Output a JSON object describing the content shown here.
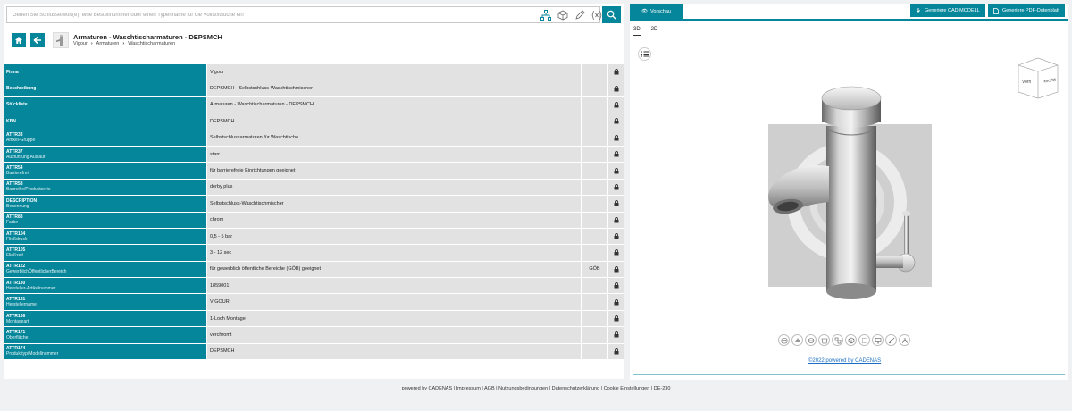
{
  "search": {
    "placeholder": "Geben Sie Schlüsselwort(e), eine Bestellnummer oder einen Typenname für die Volltextsuche ein",
    "value": ""
  },
  "toolbar_icons": [
    "hierarchy-icon",
    "cube-icon",
    "pen-icon",
    "variable-icon"
  ],
  "header": {
    "title": "Armaturen - Waschtischarmaturen - DEPSMCH",
    "breadcrumb": [
      "Vigour",
      "Armaturen",
      "Waschtischarmaturen"
    ]
  },
  "attributes": [
    {
      "key": "Firma",
      "desc": "",
      "value": "Vigour",
      "extra": ""
    },
    {
      "key": "Beschreibung",
      "desc": "",
      "value": "DEPSMCH - Selbstschluss-Waschtischmischer",
      "extra": ""
    },
    {
      "key": "Stückliste",
      "desc": "",
      "value": "Armaturen - Waschtischarmaturen - DEPSMCH",
      "extra": ""
    },
    {
      "key": "KBN",
      "desc": "",
      "value": "DEPSMCH",
      "extra": ""
    },
    {
      "key": "ATTR33",
      "desc": "Artikel-Gruppe",
      "value": "Selbstschlussarmaturen für Waschtische",
      "extra": ""
    },
    {
      "key": "ATTR37",
      "desc": "Ausführung Auslauf",
      "value": "starr",
      "extra": ""
    },
    {
      "key": "ATTR54",
      "desc": "Barrierefrei",
      "value": "für barrierefreie Einrichtungen geeignet",
      "extra": ""
    },
    {
      "key": "ATTR58",
      "desc": "Baureihe/Produktserie",
      "value": "derby plus",
      "extra": ""
    },
    {
      "key": "DESCRIPTION",
      "desc": "Benennung",
      "value": "Selbstschluss-Waschtischmischer",
      "extra": ""
    },
    {
      "key": "ATTR83",
      "desc": "Farbe",
      "value": "chrom",
      "extra": ""
    },
    {
      "key": "ATTR104",
      "desc": "Fließdruck",
      "value": "0,5 - 5 bar",
      "extra": ""
    },
    {
      "key": "ATTR105",
      "desc": "Fließzeit",
      "value": "3 - 12 sec",
      "extra": ""
    },
    {
      "key": "ATTR122",
      "desc": "GewerblichÖffentlicherBereich",
      "value": "für gewerblich öffentliche Bereiche (GÖB) geeignet",
      "extra": "GÖB"
    },
    {
      "key": "ATTR130",
      "desc": "Hersteller-Artikelnummer",
      "value": "1859001",
      "extra": ""
    },
    {
      "key": "ATTR131",
      "desc": "Herstellername",
      "value": "VIGOUR",
      "extra": ""
    },
    {
      "key": "ATTR166",
      "desc": "Montageart",
      "value": "1-Loch Montage",
      "extra": ""
    },
    {
      "key": "ATTR171",
      "desc": "Oberfläche",
      "value": "verchromt",
      "extra": ""
    },
    {
      "key": "ATTR174",
      "desc": "Produkttyp/Modellnummer",
      "value": "DEPSMCH",
      "extra": ""
    }
  ],
  "preview": {
    "tab_label": "Vorschau",
    "cad_button": "Generiere CAD MODELL",
    "pdf_button": "Generiere PDF-Datenblatt",
    "view_tabs": [
      "3D",
      "2D"
    ],
    "viewcube": {
      "front": "Vorn",
      "right": "Rechts"
    },
    "render_tools": [
      "layers-icon",
      "shading-icon",
      "wireframe-icon",
      "section-icon",
      "explode-icon",
      "box-icon",
      "hidden-lines-icon",
      "screen-icon",
      "measure-icon",
      "axis-icon"
    ],
    "powered_link": "©2022 powered by CADENAS"
  },
  "footer": "powered by CADENAS | Impressum | AGB | Nutzungsbedingungen | Datenschutzerklärung | Cookie Einstellungen | DE-230",
  "colors": {
    "accent": "#05869a",
    "cell": "#e2e2e2",
    "link": "#1a6fc4"
  }
}
